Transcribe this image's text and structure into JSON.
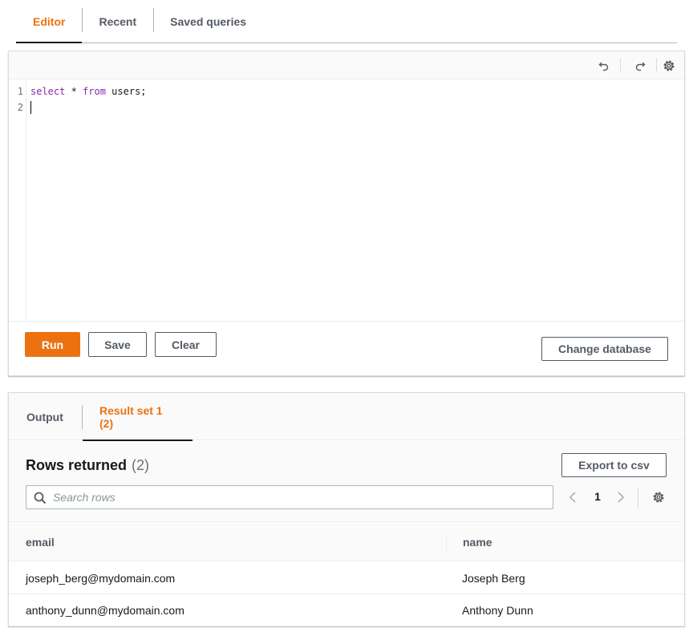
{
  "tabs": [
    {
      "label": "Editor",
      "active": true
    },
    {
      "label": "Recent",
      "active": false
    },
    {
      "label": "Saved queries",
      "active": false
    }
  ],
  "editor": {
    "toolbar_icons": [
      "undo-icon",
      "redo-icon",
      "gear-icon"
    ],
    "line_numbers": [
      "1",
      "2"
    ],
    "code": {
      "kw_select": "select",
      "star": " * ",
      "kw_from": "from",
      "rest": " users;"
    },
    "buttons": {
      "run": "Run",
      "save": "Save",
      "clear": "Clear",
      "change_database": "Change database"
    }
  },
  "results": {
    "tabs": [
      {
        "label": "Output",
        "active": false
      },
      {
        "label": "Result set 1 (2)",
        "active": true
      }
    ],
    "title": "Rows returned",
    "count": "(2)",
    "export_label": "Export to csv",
    "search_placeholder": "Search rows",
    "page": "1",
    "columns": [
      "email",
      "name"
    ],
    "rows": [
      {
        "email": "joseph_berg@mydomain.com",
        "name": "Joseph Berg"
      },
      {
        "email": "anthony_dunn@mydomain.com",
        "name": "Anthony Dunn"
      }
    ]
  },
  "colors": {
    "accent": "#ec7211",
    "text": "#16191f",
    "muted": "#545b64",
    "keyword": "#8e24aa"
  }
}
